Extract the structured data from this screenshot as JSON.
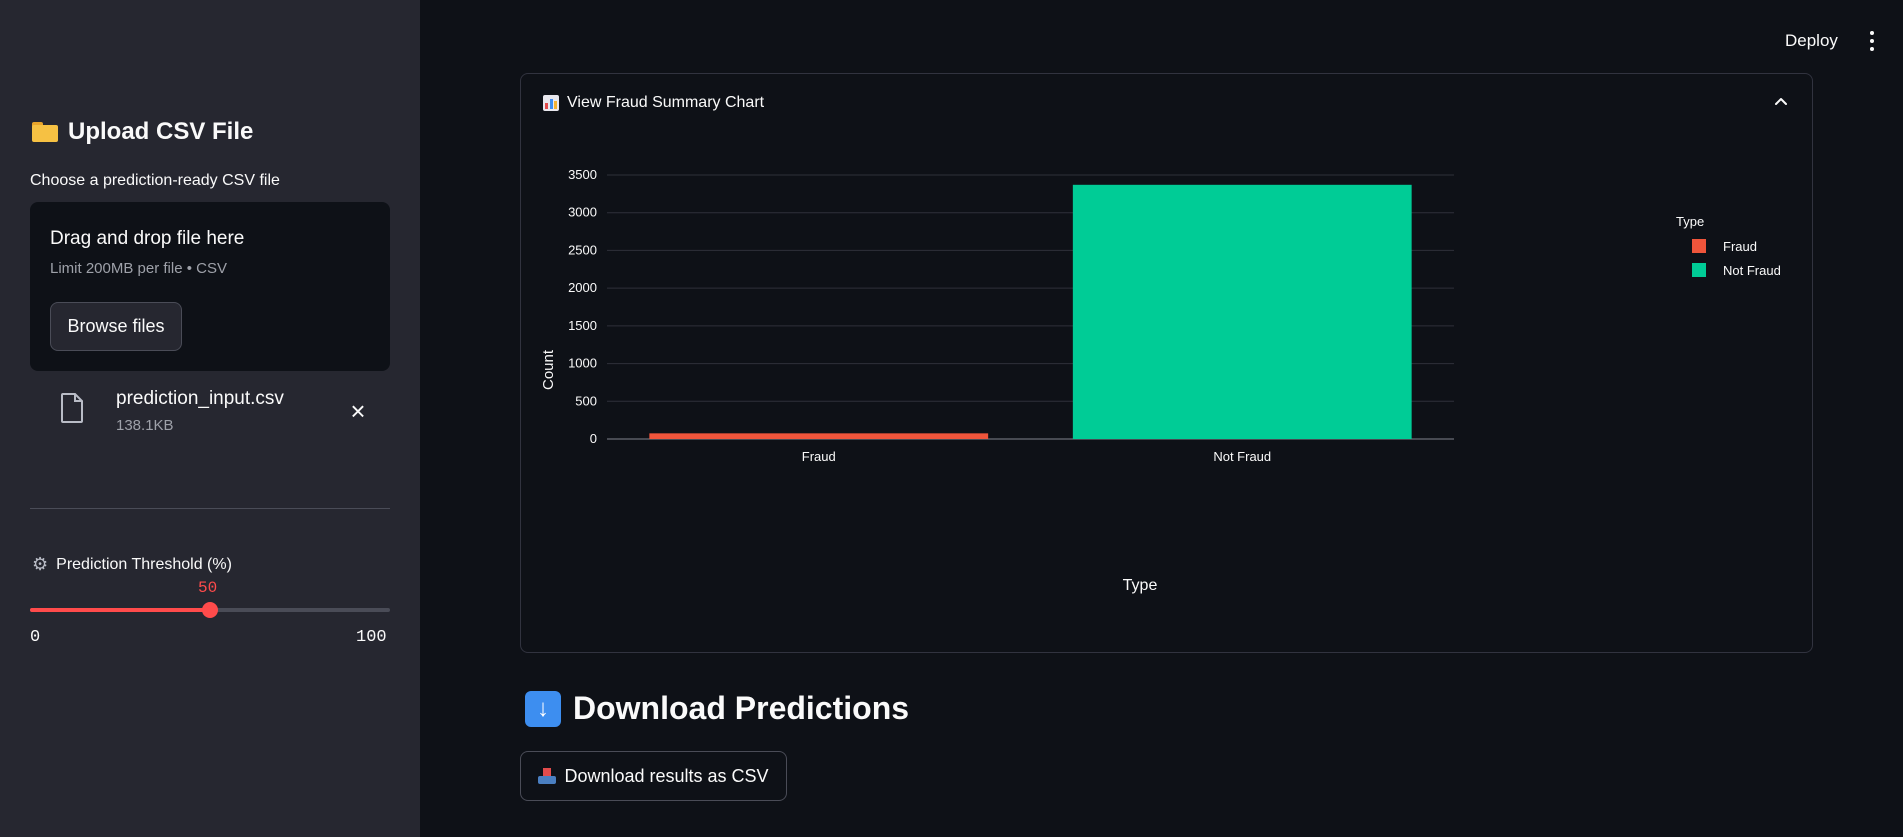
{
  "sidebar": {
    "title": "Upload CSV File",
    "title_icon": "folder-icon",
    "uploader_label": "Choose a prediction-ready CSV file",
    "dropzone_title": "Drag and drop file here",
    "dropzone_limit": "Limit 200MB per file • CSV",
    "browse_label": "Browse files",
    "file": {
      "name": "prediction_input.csv",
      "size": "138.1KB"
    },
    "threshold": {
      "label": "Prediction Threshold (%)",
      "value": "50",
      "min": "0",
      "max": "100",
      "fraction": 0.5
    }
  },
  "header": {
    "deploy_label": "Deploy"
  },
  "expander": {
    "title": "View Fraud Summary Chart",
    "icon": "bar-chart-emoji",
    "expanded": true
  },
  "download": {
    "heading": "Download Predictions",
    "heading_icon": "down-arrow-emoji",
    "button_label": "Download results as CSV",
    "button_icon": "inbox-tray-emoji"
  },
  "colors": {
    "accent": "#ff4b4b",
    "fraud": "#ef553b",
    "not_fraud": "#00cc96"
  },
  "chart_data": {
    "type": "bar",
    "categories": [
      "Fraud",
      "Not Fraud"
    ],
    "values": [
      75,
      3370
    ],
    "colors": [
      "#ef553b",
      "#00cc96"
    ],
    "xlabel": "Type",
    "ylabel": "Count",
    "ylim": [
      0,
      3500
    ],
    "yticks": [
      0,
      500,
      1000,
      1500,
      2000,
      2500,
      3000,
      3500
    ],
    "legend": {
      "title": "Type",
      "placement": "right",
      "entries": [
        "Fraud",
        "Not Fraud"
      ]
    },
    "grid": true
  }
}
